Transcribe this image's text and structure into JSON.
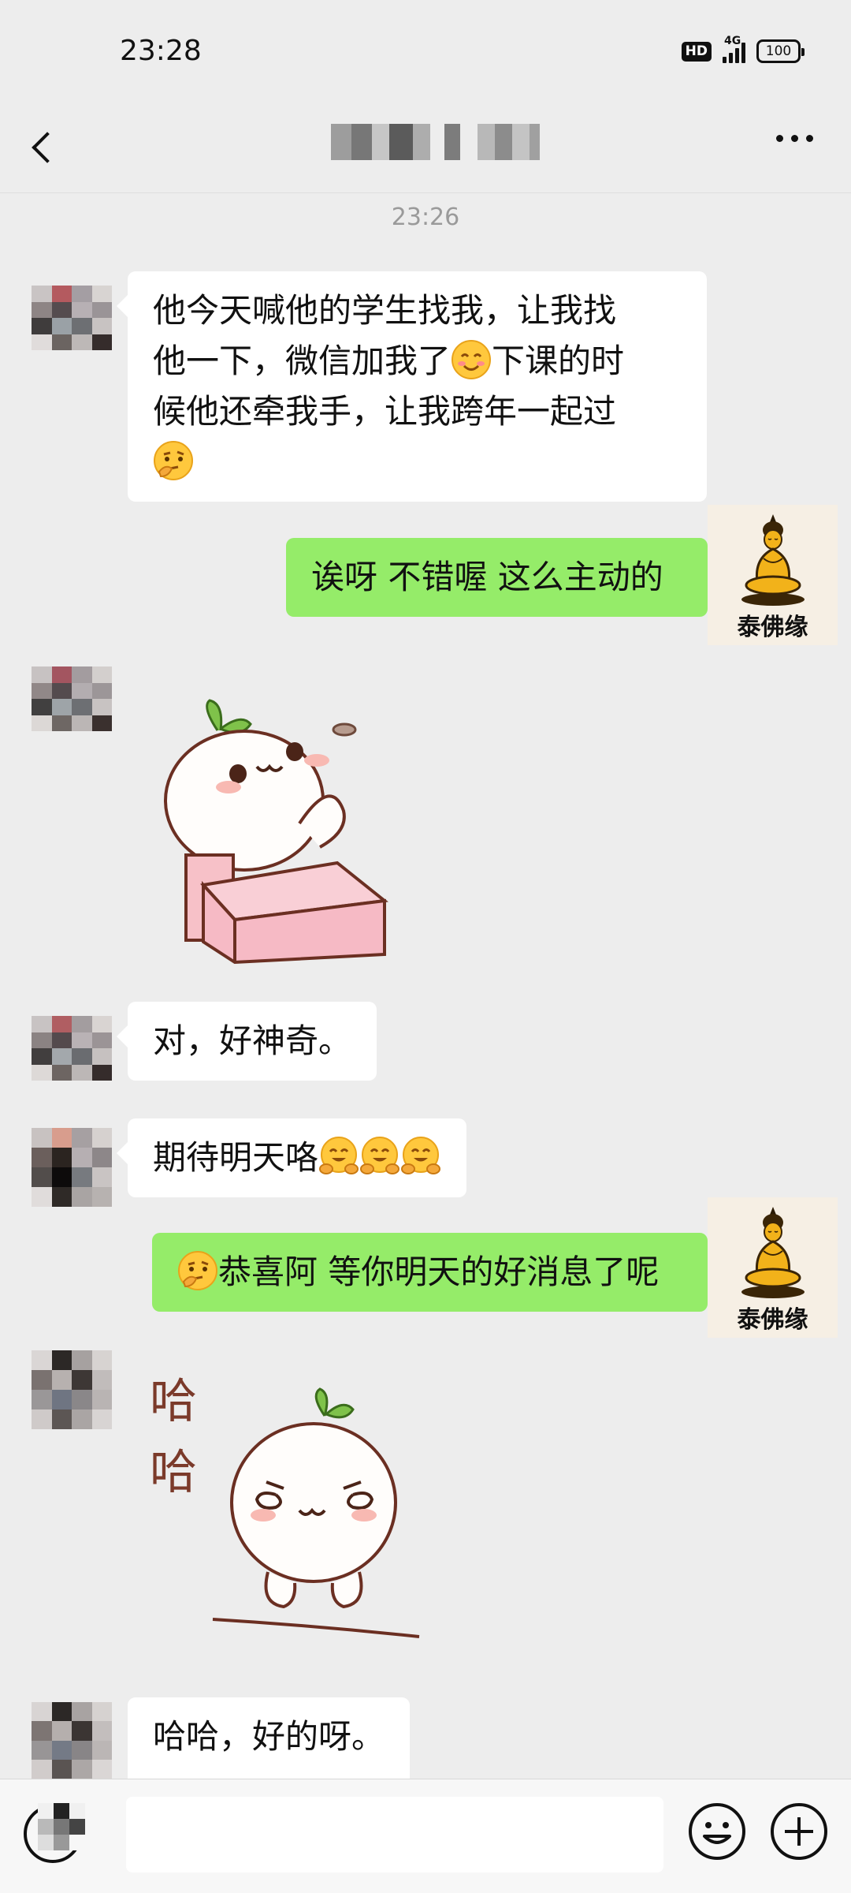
{
  "status_bar": {
    "time": "23:28",
    "hd": "HD",
    "network": "4G",
    "battery": "100"
  },
  "header": {
    "title": "",
    "back_icon": "chevron-left-icon",
    "more_icon": "more-dots-icon"
  },
  "timestamp": "23:26",
  "messages": [
    {
      "side": "in",
      "text_parts": [
        "他今天喊他的学生找我，让我找",
        "他一下，微信加我了",
        "下课的时",
        "候他还牵我手，让我跨年一起过"
      ],
      "emojis": [
        "smiling-face-emoji",
        "thinking-face-emoji"
      ]
    },
    {
      "side": "out",
      "text": "诶呀 不错喔  这么主动的"
    },
    {
      "side": "in",
      "sticker": "waving-bun-sticker"
    },
    {
      "side": "in",
      "text": "对，好神奇。"
    },
    {
      "side": "in",
      "text": "期待明天咯",
      "emojis": [
        "hugging-face-emoji",
        "hugging-face-emoji",
        "hugging-face-emoji"
      ]
    },
    {
      "side": "out",
      "text": "恭喜阿 等你明天的好消息了呢",
      "emojis": [
        "thinking-face-emoji"
      ]
    },
    {
      "side": "in",
      "sticker": "laughing-bun-sticker",
      "sticker_text": [
        "哈",
        "哈"
      ]
    },
    {
      "side": "in",
      "text": "哈哈，好的呀。"
    }
  ],
  "self_avatar": {
    "name": "泰佛缘"
  },
  "input_bar": {
    "placeholder": "",
    "voice_icon": "voice-icon",
    "emoji_icon": "emoji-icon",
    "plus_icon": "plus-icon"
  },
  "colors": {
    "background": "#ededed",
    "out_bubble": "#95ec69",
    "in_bubble": "#ffffff"
  }
}
